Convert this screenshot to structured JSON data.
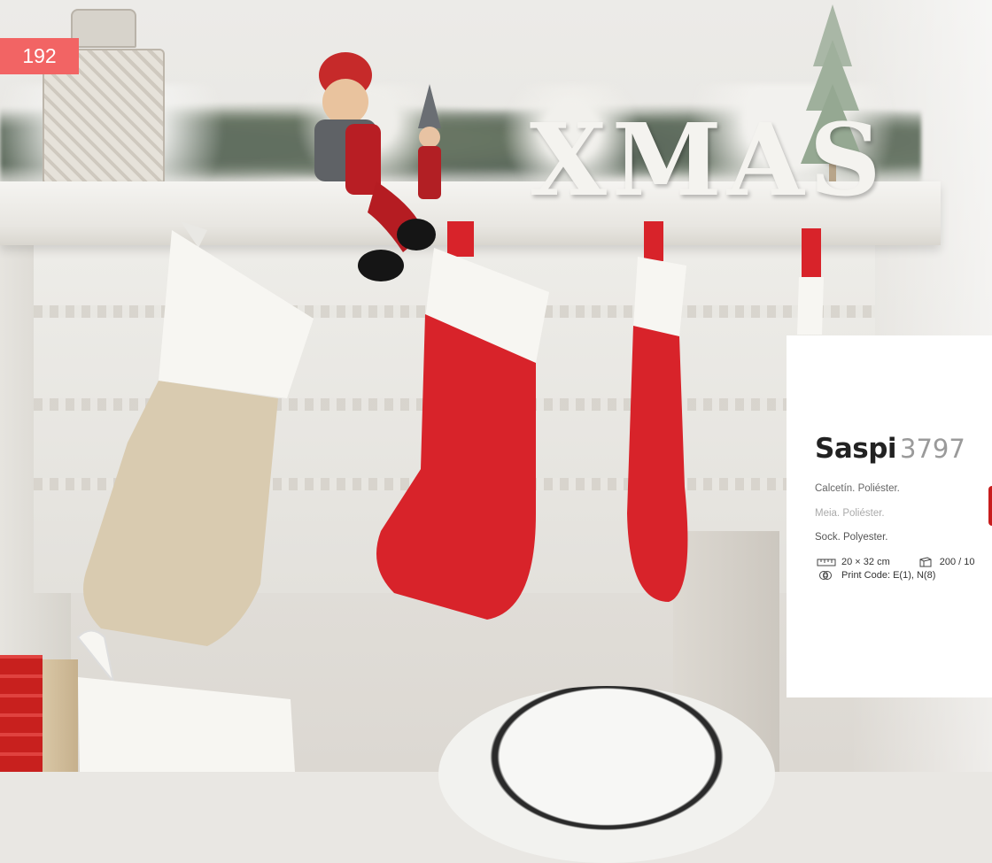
{
  "page": {
    "number": "192"
  },
  "backdrop": {
    "decor_word": [
      "X",
      "M",
      "A",
      "S"
    ]
  },
  "product": {
    "name": "Saspi",
    "code": "3797",
    "desc_es": "Calcetín. Poliéster.",
    "desc_pt": "Meia. Poliéster.",
    "desc_en": "Sock. Polyester.",
    "dimensions": "20 × 32 cm",
    "packaging": "200 / 10",
    "print_code": "Print Code: E(1), N(8)"
  },
  "icons": {
    "ruler": "ruler-icon",
    "box": "box-icon",
    "print": "print-technique-icon"
  },
  "colors": {
    "page_badge": "#f26464",
    "stocking_red": "#d8232a",
    "stocking_white": "#f7f6f2",
    "stocking_burlap": "#d9cbb0"
  }
}
